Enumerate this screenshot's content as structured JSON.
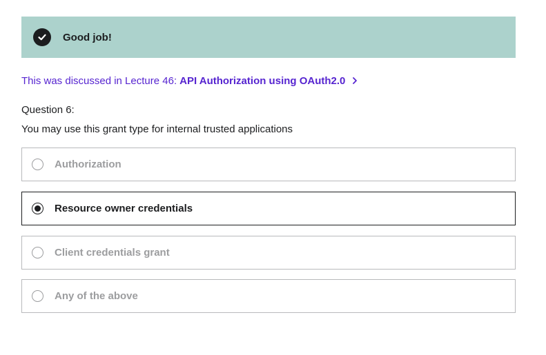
{
  "alert": {
    "icon": "check-circle-icon",
    "message": "Good job!",
    "background_color": "#acd2cc"
  },
  "lecture_reference": {
    "prefix": "This was discussed in Lecture 46:",
    "title": "API Authorization using OAuth2.0",
    "icon": "chevron-right-icon",
    "color": "#5624d0"
  },
  "question": {
    "number_label": "Question 6:",
    "prompt": "You may use this grant type for internal trusted applications"
  },
  "options": [
    {
      "label": "Authorization",
      "selected": false
    },
    {
      "label": "Resource owner credentials",
      "selected": true
    },
    {
      "label": "Client credentials grant",
      "selected": false
    },
    {
      "label": "Any of the above",
      "selected": false
    }
  ]
}
